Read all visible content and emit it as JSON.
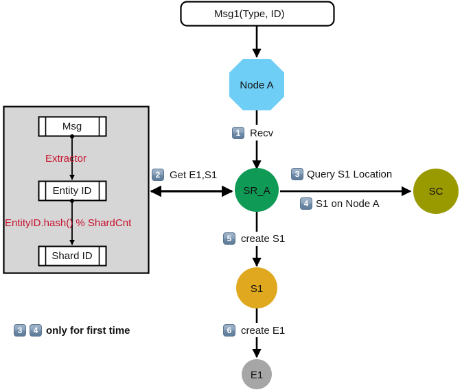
{
  "diagram": {
    "title_box": {
      "label": "Msg1(Type, ID)"
    },
    "nodes": {
      "node_a": {
        "label": "Node A",
        "shape": "octagon",
        "color": "#6ecef5"
      },
      "sr_a": {
        "label": "SR_A",
        "shape": "circle",
        "color": "#0f9a55"
      },
      "sc": {
        "label": "SC",
        "shape": "circle",
        "color": "#999900"
      },
      "s1": {
        "label": "S1",
        "shape": "circle",
        "color": "#e0a81e"
      },
      "e1": {
        "label": "E1",
        "shape": "circle",
        "color": "#a6a6a6"
      }
    },
    "steps": [
      {
        "num": "1",
        "label": "Recv"
      },
      {
        "num": "2",
        "label": "Get E1,S1"
      },
      {
        "num": "3",
        "label": "Query S1 Location"
      },
      {
        "num": "4",
        "label": "S1 on Node A"
      },
      {
        "num": "5",
        "label": "create  S1"
      },
      {
        "num": "6",
        "label": "create  E1"
      }
    ],
    "legend": {
      "num_a": "3",
      "num_b": "4",
      "text": "only for first time"
    },
    "extractor_panel": {
      "boxes": [
        {
          "label": "Msg"
        },
        {
          "label": "Entity ID"
        },
        {
          "label": "Shard ID"
        }
      ],
      "annotations": [
        {
          "label": "Extractor",
          "color": "#c8102e"
        },
        {
          "label": "EntityID.hash() % ShardCnt",
          "color": "#c8102e"
        }
      ]
    }
  }
}
